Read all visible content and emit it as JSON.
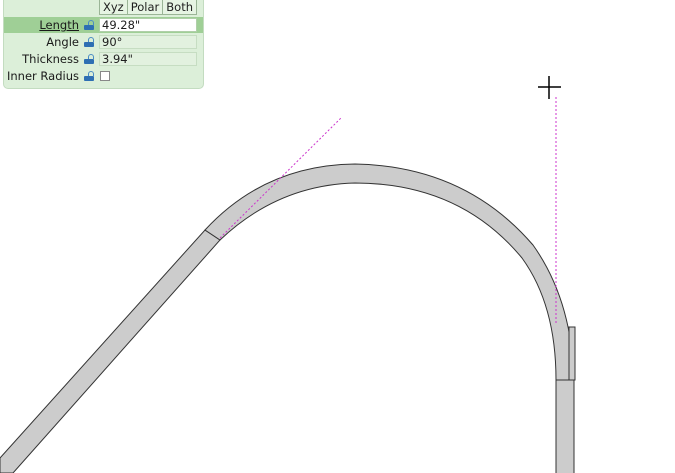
{
  "panel": {
    "tabs": [
      {
        "label": "Xyz"
      },
      {
        "label": "Polar"
      },
      {
        "label": "Both"
      }
    ],
    "rows": [
      {
        "label": "Length",
        "value": "49.28\"",
        "active": true
      },
      {
        "label": "Angle",
        "value": "90°"
      },
      {
        "label": "Thickness",
        "value": "3.94\""
      },
      {
        "label": "Inner Radius",
        "checked": false
      }
    ]
  },
  "canvas": {
    "guide_color": "#cc33cc",
    "wall_fill": "#cccccc",
    "wall_stroke": "#333333"
  }
}
